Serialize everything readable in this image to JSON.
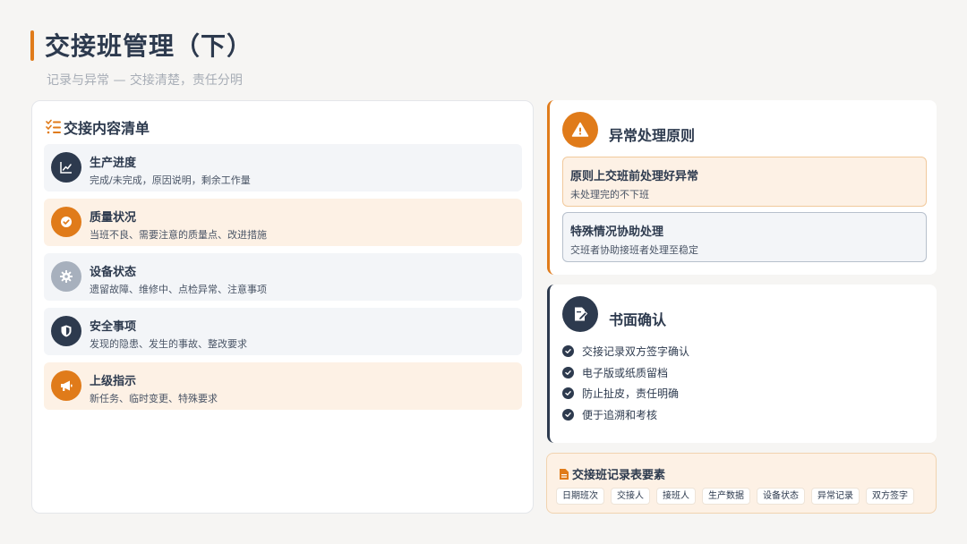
{
  "header": {
    "title": "交接班管理（下）",
    "subtitle": "记录与异常 — 交接清楚，责任分明"
  },
  "colors": {
    "accent": "#e07b1a",
    "navy": "#2d3a4e",
    "grey": "#a7b0bd"
  },
  "checklist": {
    "heading": "交接内容清单",
    "items": [
      {
        "title": "生产进度",
        "desc": "完成/未完成，原因说明，剩余工作量",
        "icon": "chart-line-icon"
      },
      {
        "title": "质量状况",
        "desc": "当班不良、需要注意的质量点、改进措施",
        "icon": "check-badge-icon"
      },
      {
        "title": "设备状态",
        "desc": "遗留故障、维修中、点检异常、注意事项",
        "icon": "gear-icon"
      },
      {
        "title": "安全事项",
        "desc": "发现的隐患、发生的事故、整改要求",
        "icon": "shield-icon"
      },
      {
        "title": "上级指示",
        "desc": "新任务、临时变更、特殊要求",
        "icon": "megaphone-icon"
      }
    ]
  },
  "anomaly": {
    "title": "异常处理原则",
    "icon": "warning-icon",
    "principles": [
      {
        "title": "原则上交班前处理好异常",
        "desc": "未处理完的不下班"
      },
      {
        "title": "特殊情况协助处理",
        "desc": "交班者协助接班者处理至稳定"
      }
    ]
  },
  "written": {
    "title": "书面确认",
    "icon": "signature-icon",
    "checks": [
      "交接记录双方签字确认",
      "电子版或纸质留档",
      "防止扯皮，责任明确",
      "便于追溯和考核"
    ]
  },
  "elements": {
    "title": "交接班记录表要素",
    "icon": "document-icon",
    "tags": [
      "日期班次",
      "交接人",
      "接班人",
      "生产数据",
      "设备状态",
      "异常记录",
      "双方签字"
    ]
  }
}
